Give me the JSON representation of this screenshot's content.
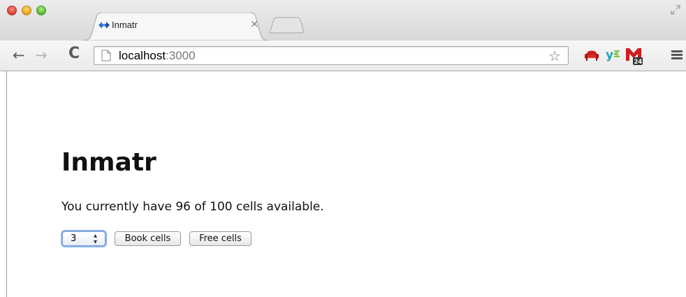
{
  "browser": {
    "tab": {
      "title": "Inmatr",
      "close_glyph": "×",
      "favicon": "diamond-arrows-icon"
    },
    "toolbar": {
      "back_glyph": "←",
      "forward_glyph": "→",
      "reload_glyph": "C",
      "address": {
        "host": "localhost",
        "port": ":3000"
      },
      "bookmark_glyph": "☆",
      "extensions": [
        "armchair-icon",
        "ys-icon",
        "mail-24-icon"
      ],
      "mail_badge": "24"
    }
  },
  "page": {
    "heading": "Inmatr",
    "status": "You currently have 96 of 100 cells available.",
    "cells_select": {
      "value": "3",
      "arrows": "⬍"
    },
    "book_button": "Book cells",
    "free_button": "Free cells"
  },
  "colors": {
    "accent_select_focus": "#8ab4ee",
    "favicon_blue": "#2a6fd6",
    "ext_red": "#cc1f1f",
    "ext_teal": "#1aa6b7"
  }
}
